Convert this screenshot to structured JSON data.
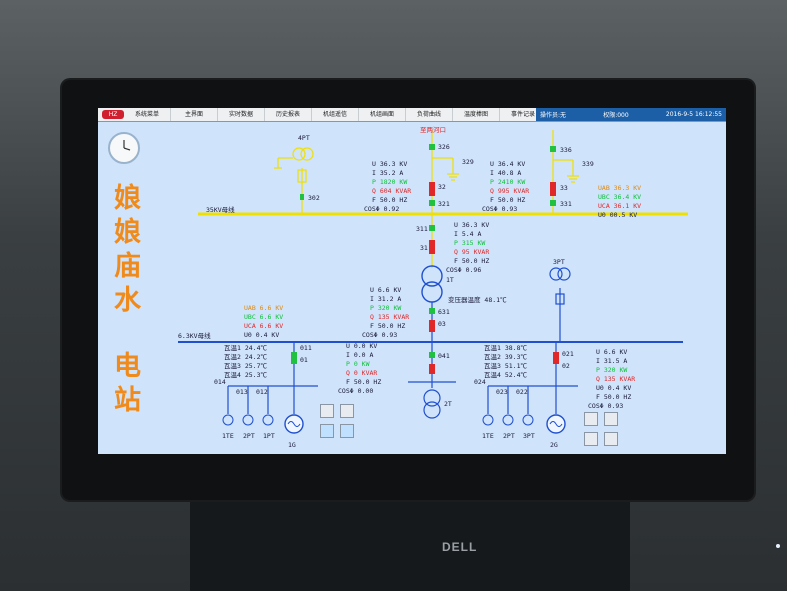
{
  "menu": [
    "系统菜单",
    "主界面",
    "实时数据",
    "历史报表",
    "机组遥信",
    "机组画面",
    "负荷曲线",
    "温度棒图",
    "事件记录"
  ],
  "status": {
    "user": "操作员:无",
    "level": "权限:000",
    "datetime": "2016-9-5   16:12:55"
  },
  "station_title": [
    "娘",
    "娘",
    "庙",
    "水",
    "电",
    "站"
  ],
  "bus_35kv": "35KV母线",
  "bus_6kv": "6.3KV母线",
  "line_tag": "至两河口",
  "pt_label": "4PT",
  "pt_switch": "302",
  "line1": {
    "U": "36.3",
    "I": "35.2",
    "P": "1820",
    "Q": "604",
    "F": "50.0",
    "cos": "0.92"
  },
  "line2": {
    "U": "36.4",
    "I": "40.8",
    "P": "2410",
    "Q": "995",
    "F": "50.0",
    "cos": "0.93"
  },
  "tr_hv": {
    "U": "36.3",
    "I": "5.4",
    "P": "315",
    "Q": "95",
    "F": "50.0",
    "cos": "0.96"
  },
  "tr_lv": {
    "U": "6.6",
    "I": "31.2",
    "P": "320",
    "Q": "135",
    "F": "50.0",
    "cos": "0.93",
    "oil_temp": "48.1℃"
  },
  "bus35_volts": {
    "UAB": "36.3",
    "UBC": "36.4",
    "UCA": "36.1",
    "U0": "00.5"
  },
  "bus6_volts": {
    "UAB": "6.6",
    "UBC": "6.6",
    "UCA": "6.6",
    "U0": "0.4"
  },
  "g1": {
    "U": "0.0",
    "I": "0.0",
    "P": "0",
    "Q": "0",
    "F": "50.0",
    "cos": "0.00",
    "temps": [
      "24.4℃",
      "24.2℃",
      "25.7℃",
      "25.3℃"
    ]
  },
  "g2": {
    "U": "6.6",
    "I": "31.5",
    "P": "320",
    "Q": "135",
    "U0": "0.4",
    "F": "50.0",
    "cos": "0.93",
    "temps": [
      "38.8℃",
      "39.3℃",
      "51.1℃",
      "52.4℃"
    ]
  },
  "switches": {
    "s326": "326",
    "s329": "329",
    "s32": "32",
    "s321": "321",
    "s336": "336",
    "s339": "339",
    "s33": "33",
    "s331": "331",
    "s311": "311",
    "s31": "31",
    "s631": "631",
    "s03": "03",
    "s041": "041",
    "s011": "011",
    "s01": "01",
    "s014": "014",
    "s013": "013",
    "s012": "012",
    "s021": "021",
    "s02": "02",
    "s024": "024",
    "s023": "023",
    "s022": "022"
  },
  "units": {
    "kv": "KV",
    "a": "A",
    "kw": "KW",
    "kvar": "KVAR",
    "hz": "HZ"
  },
  "labels": {
    "t1": "1T",
    "t2": "2T",
    "g1": "1G",
    "g2": "2G",
    "pt1": "1TE",
    "pt2": "2PT",
    "pt3": "1PT",
    "pt5": "3PT",
    "pt6": "1TE",
    "pt7": "2PT",
    "pt8": "3PT",
    "oil": "变压器温度",
    "temp_prefix": [
      "瓦温1",
      "瓦温2",
      "瓦温3",
      "瓦温4"
    ]
  },
  "brand": "DELL",
  "colors": {
    "bus": "#f0e000",
    "bus6": "#2050d0",
    "breaker": "#e02828",
    "closed": "#20c040",
    "text_dark": "#1a1a3a",
    "title": "#f08a1a"
  }
}
